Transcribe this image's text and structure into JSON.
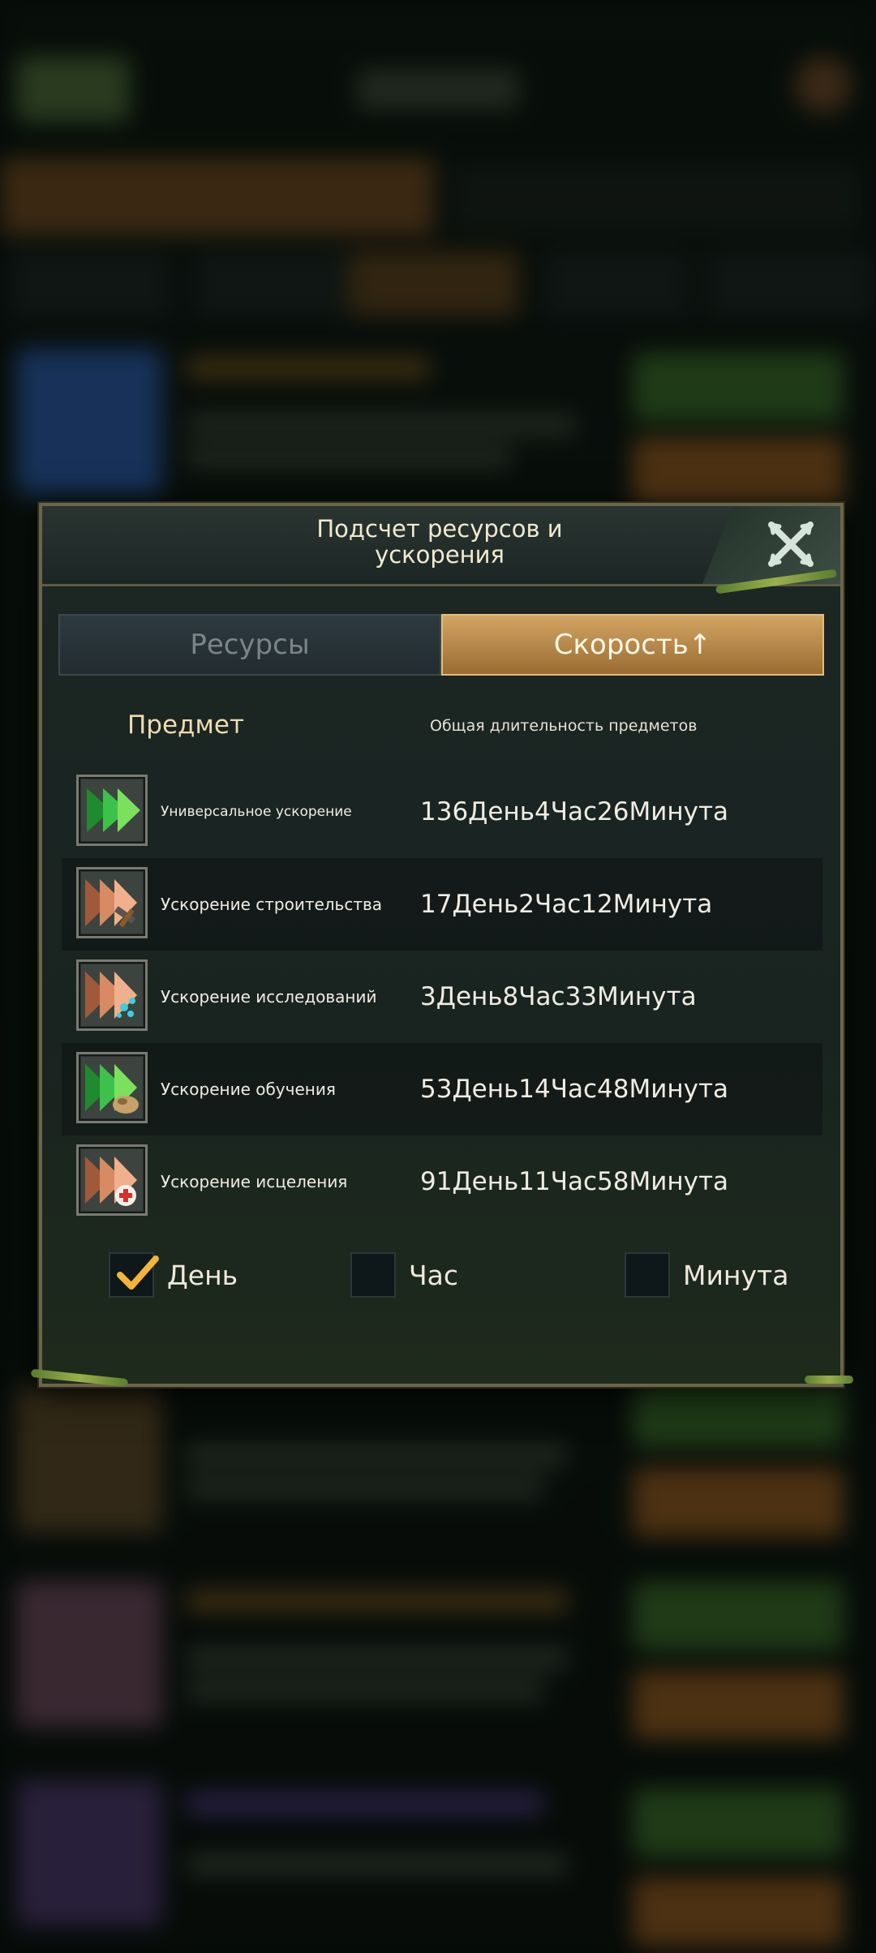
{
  "modal": {
    "title_line1": "Подсчет ресурсов и",
    "title_line2": "ускорения",
    "close_icon": "close-x-icon"
  },
  "tabs": [
    {
      "label": "Ресурсы",
      "active": false
    },
    {
      "label": "Скорость↑",
      "active": true
    }
  ],
  "columns": {
    "item": "Предмет",
    "duration": "Общая длительность предметов"
  },
  "items": [
    {
      "name": "Универсальное ускорение",
      "duration": "136День4Час26Минута",
      "icon": "universal-speedup-icon"
    },
    {
      "name": "Ускорение строительства",
      "duration": "17День2Час12Минута",
      "icon": "construction-speedup-icon"
    },
    {
      "name": "Ускорение исследований",
      "duration": "3День8Час33Минута",
      "icon": "research-speedup-icon"
    },
    {
      "name": "Ускорение обучения",
      "duration": "53День14Час48Минута",
      "icon": "training-speedup-icon"
    },
    {
      "name": "Ускорение исцеления",
      "duration": "91День11Час58Минута",
      "icon": "healing-speedup-icon"
    }
  ],
  "units": [
    {
      "label": "День",
      "checked": true
    },
    {
      "label": "Час",
      "checked": false
    },
    {
      "label": "Минута",
      "checked": false
    }
  ],
  "colors": {
    "accent_gold": "#c79a5a",
    "panel": "#1c2624",
    "text": "#f0ece4"
  }
}
